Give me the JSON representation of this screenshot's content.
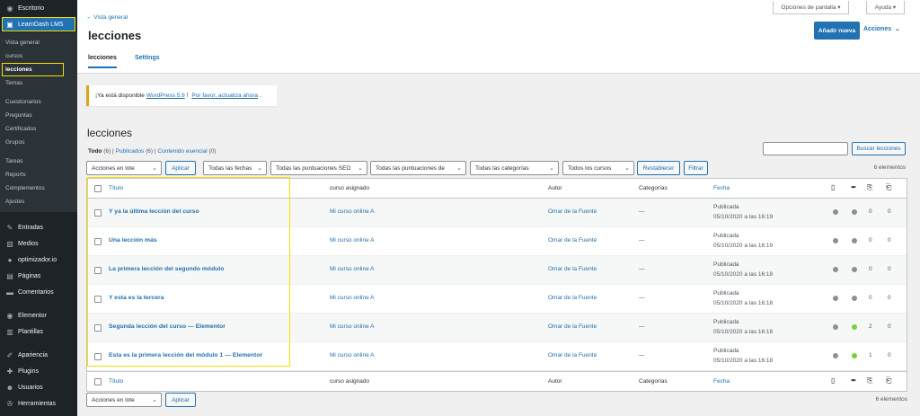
{
  "sidebar": {
    "top": [
      {
        "label": "Escritorio",
        "icon": "dashboard-icon",
        "glyph": "◉"
      }
    ],
    "active": {
      "label": "LearnDash LMS",
      "icon": "learndash-icon",
      "glyph": "▣"
    },
    "submenu": [
      "Vista general",
      "cursos",
      "lecciones",
      "Temas",
      "Cuestionarios",
      "Preguntas",
      "Certificados",
      "Grupos",
      "Tareas",
      "Reports",
      "Complementos",
      "Ajustes"
    ],
    "items": [
      {
        "label": "Entradas",
        "icon": "pin-icon",
        "glyph": "✎"
      },
      {
        "label": "Medios",
        "icon": "media-icon",
        "glyph": "▧"
      },
      {
        "label": "optimizador.io",
        "icon": "plugin-logo-icon",
        "glyph": "●"
      },
      {
        "label": "Páginas",
        "icon": "pages-icon",
        "glyph": "▤"
      },
      {
        "label": "Comentarios",
        "icon": "comments-icon",
        "glyph": "▬"
      },
      {
        "label": "Elementor",
        "icon": "elementor-icon",
        "glyph": "◉"
      },
      {
        "label": "Plantillas",
        "icon": "templates-icon",
        "glyph": "▥"
      },
      {
        "label": "Apariencia",
        "icon": "appearance-icon",
        "glyph": "✐"
      },
      {
        "label": "Plugins",
        "icon": "plugins-icon",
        "glyph": "✚"
      },
      {
        "label": "Usuarios",
        "icon": "users-icon",
        "glyph": "☻"
      },
      {
        "label": "Herramientas",
        "icon": "tools-icon",
        "glyph": "✇"
      }
    ]
  },
  "topbar": {
    "screen_options": "Opciones de pantalla ▾",
    "help": "Ayuda ▾"
  },
  "header": {
    "back_link": "← Vista general",
    "title": "lecciones",
    "add_new": "Añadir nueva",
    "actions": "Acciones",
    "tabs": [
      "lecciones",
      "Settings"
    ]
  },
  "notice": {
    "prefix": "¡Ya está disponible",
    "link1": "WordPress 5.9",
    "suffix": "!",
    "link2": "Por favor, actualiza ahora",
    "end": "."
  },
  "list": {
    "title": "lecciones",
    "views": {
      "all": "Todo",
      "all_count": "(6)",
      "published": "Publicados",
      "published_count": "(6)",
      "essential": "Contenido esencial",
      "essential_count": "(0)",
      "sep": "|"
    },
    "search_button": "Buscar lecciones",
    "search_value": "",
    "filters": {
      "bulk": "Acciones en lote",
      "apply": "Aplicar",
      "dates": "Todas las fechas",
      "seo1": "Todas las puntuaciones SEO",
      "seo2": "Todas las puntuaciones de",
      "cats": "Todas las categorías",
      "courses": "Todos los cursos",
      "reset": "Restablecer",
      "filter": "Filtrar"
    },
    "count": "6 elementos",
    "columns": {
      "title": "Título",
      "course": "curso asignado",
      "author": "Autor",
      "categories": "Categorías",
      "date": "Fecha"
    },
    "rows": [
      {
        "title": "Y ya la última lección del curso",
        "course": "Mi curso online A",
        "author": "Omar de la Fuente",
        "cat": "—",
        "status": "Publicada",
        "date": "05/10/2020 a las 16:19",
        "seo": "#8c8f94",
        "read": "#8c8f94",
        "links_in": "0",
        "links_out": "0"
      },
      {
        "title": "Una lección más",
        "course": "Mi curso online A",
        "author": "Omar de la Fuente",
        "cat": "—",
        "status": "Publicada",
        "date": "05/10/2020 a las 16:19",
        "seo": "#8c8f94",
        "read": "#8c8f94",
        "links_in": "0",
        "links_out": "0"
      },
      {
        "title": "La primera lección del segundo módulo",
        "course": "Mi curso online A",
        "author": "Omar de la Fuente",
        "cat": "—",
        "status": "Publicada",
        "date": "05/10/2020 a las 16:18",
        "seo": "#8c8f94",
        "read": "#8c8f94",
        "links_in": "0",
        "links_out": "0"
      },
      {
        "title": "Y esta es la tercera",
        "course": "Mi curso online A",
        "author": "Omar de la Fuente",
        "cat": "—",
        "status": "Publicada",
        "date": "05/10/2020 a las 16:18",
        "seo": "#8c8f94",
        "read": "#8c8f94",
        "links_in": "0",
        "links_out": "0"
      },
      {
        "title": "Segunda lección del curso — Elementor",
        "course": "Mi curso online A",
        "author": "Omar de la Fuente",
        "cat": "—",
        "status": "Publicada",
        "date": "05/10/2020 a las 16:18",
        "seo": "#8c8f94",
        "read": "#7ad03a",
        "links_in": "2",
        "links_out": "0"
      },
      {
        "title": "Esta es la primera lección del módulo 1 — Elementor",
        "course": "Mi curso online A",
        "author": "Omar de la Fuente",
        "cat": "—",
        "status": "Publicada",
        "date": "05/10/2020 a las 16:18",
        "seo": "#8c8f94",
        "read": "#7ad03a",
        "links_in": "1",
        "links_out": "0"
      }
    ],
    "column_icons": [
      {
        "name": "seo-score-icon",
        "glyph": "▯"
      },
      {
        "name": "readability-icon",
        "glyph": "✒"
      },
      {
        "name": "internal-links-in-icon",
        "glyph": "⎘"
      },
      {
        "name": "internal-links-out-icon",
        "glyph": "⎗"
      }
    ]
  },
  "colors": {
    "accent": "#2271b1",
    "highlight": "#f5e000",
    "sidebar": "#1d2327"
  }
}
